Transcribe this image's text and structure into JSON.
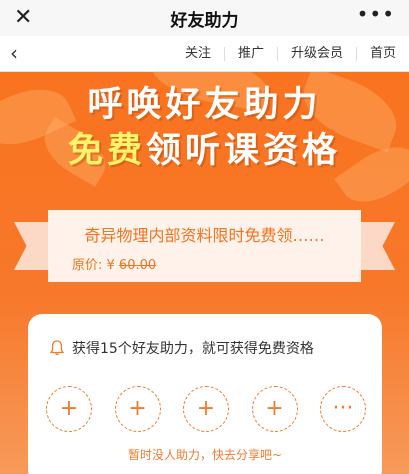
{
  "titlebar": {
    "close": "✕",
    "title": "好友助力",
    "more": "•••"
  },
  "navbar": {
    "back": "‹",
    "links": [
      "关注",
      "推广",
      "升级会员",
      "首页"
    ]
  },
  "banner": {
    "headline1": "呼唤好友助力",
    "headline2_highlight": "免费",
    "headline2_rest": "领听课资格"
  },
  "ribbon": {
    "course": "奇异物理内部资料限时免费领……",
    "price_label": "原价: ¥ ",
    "price_value": "60.00"
  },
  "card": {
    "tip": "获得15个好友助力，就可获得免费资格",
    "slots": [
      "+",
      "+",
      "+",
      "+",
      "···"
    ],
    "note": "暂时没人助力，快去分享吧~"
  },
  "colors": {
    "accent": "#f47a2c",
    "banner": "#f9731f",
    "highlight": "#fff46a"
  }
}
